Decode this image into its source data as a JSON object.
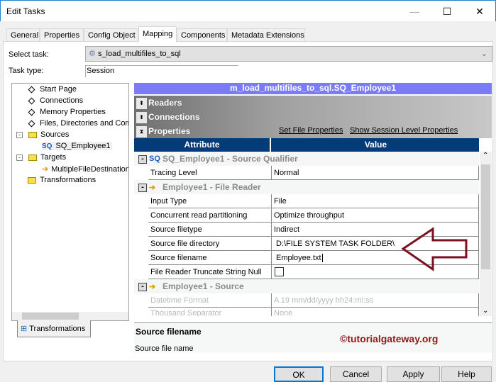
{
  "window": {
    "title": "Edit Tasks",
    "controls": [
      "minimize",
      "maximize",
      "close"
    ]
  },
  "tabs": [
    {
      "label": "General"
    },
    {
      "label": "Properties"
    },
    {
      "label": "Config Object"
    },
    {
      "label": "Mapping",
      "selected": true
    },
    {
      "label": "Components"
    },
    {
      "label": "Metadata Extensions"
    }
  ],
  "form": {
    "select_task_label": "Select task:",
    "select_task_value": "s_load_multifiles_to_sql",
    "task_type_label": "Task type:",
    "task_type_value": "Session"
  },
  "tree": {
    "items": [
      "Start Page",
      "Connections",
      "Memory Properties",
      "Files, Directories and Commands"
    ],
    "sources": "Sources",
    "source_child": "SQ_Employee1",
    "targets": "Targets",
    "target_child": "MultipleFileDestination",
    "transformations": "Transformations",
    "bottom_tab": "Transformations"
  },
  "mapping": {
    "header": "m_load_multifiles_to_sql.SQ_Employee1",
    "sections": [
      "Readers",
      "Connections",
      "Properties"
    ],
    "links": {
      "set_file_properties": "Set File Properties",
      "show_session": "Show Session Level Properties"
    },
    "columns": [
      "Attribute",
      "Value"
    ],
    "groups": {
      "sq": "SQ_Employee1 - Source Qualifier",
      "reader": "Employee1 - File Reader",
      "source": "Employee1 - Source"
    },
    "rows": [
      {
        "attribute": "Tracing Level",
        "value": "Normal"
      },
      {
        "attribute": "Input Type",
        "value": "File"
      },
      {
        "attribute": "Concurrent read partitioning",
        "value": "Optimize throughput"
      },
      {
        "attribute": "Source filetype",
        "value": "Indirect"
      },
      {
        "attribute": "Source file directory",
        "value": "D:\\FILE SYSTEM TASK FOLDER\\"
      },
      {
        "attribute": "Source filename",
        "value": "Employee.txt"
      },
      {
        "attribute": "File Reader Truncate String Null",
        "value": ""
      },
      {
        "attribute": "Datetime Format",
        "value": "A  19 mm/dd/yyyy hh24:mi:ss"
      },
      {
        "attribute": "Thousand Separator",
        "value": "None"
      }
    ],
    "sq_badge": "SQ"
  },
  "description": {
    "title": "Source filename",
    "text": "Source file name"
  },
  "watermark": "©tutorialgateway.org",
  "buttons": {
    "ok": "OK",
    "cancel": "Cancel",
    "apply": "Apply",
    "help": "Help"
  },
  "colors": {
    "header": "#7b7cf5",
    "table_header": "#003c78",
    "arrow": "#7b1020",
    "watermark": "#8b1a1a"
  }
}
